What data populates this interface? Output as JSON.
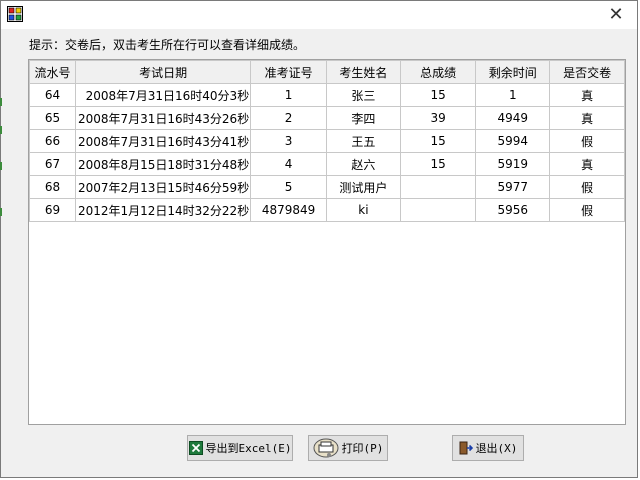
{
  "window": {
    "close_glyph": "✕"
  },
  "hint": "提示：交卷后，双击考生所在行可以查看详细成绩。",
  "table": {
    "headers": [
      "流水号",
      "考试日期",
      "准考证号",
      "考生姓名",
      "总成绩",
      "剩余时间",
      "是否交卷"
    ],
    "rows": [
      [
        "64",
        "2008年7月31日16时40分3秒",
        "1",
        "张三",
        "15",
        "1",
        "真"
      ],
      [
        "65",
        "2008年7月31日16时43分26秒",
        "2",
        "李四",
        "39",
        "4949",
        "真"
      ],
      [
        "66",
        "2008年7月31日16时43分41秒",
        "3",
        "王五",
        "15",
        "5994",
        "假"
      ],
      [
        "67",
        "2008年8月15日18时31分48秒",
        "4",
        "赵六",
        "15",
        "5919",
        "真"
      ],
      [
        "68",
        "2007年2月13日15时46分59秒",
        "5",
        "测试用户",
        "",
        "5977",
        "假"
      ],
      [
        "69",
        "2012年1月12日14时32分22秒",
        "4879849",
        "ki",
        "",
        "5956",
        "假"
      ]
    ]
  },
  "buttons": {
    "export": "导出到Excel(E)",
    "print": "打印(P)",
    "exit": "退出(X)"
  },
  "icons": {
    "app": "app-icon",
    "export": "excel-icon",
    "print": "printer-icon",
    "exit": "exit-door-icon"
  }
}
